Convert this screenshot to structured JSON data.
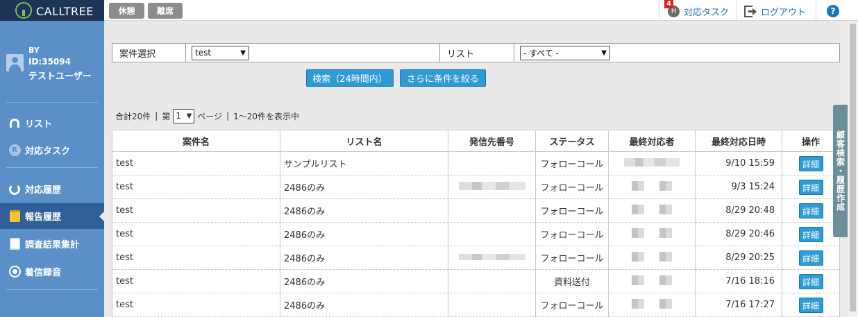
{
  "app": {
    "logo_text": "CALLTREE"
  },
  "topbar": {
    "buttons": [
      "休憩",
      "離席"
    ],
    "task": {
      "badge": "4",
      "icon_letter": "H",
      "label": "対応タスク"
    },
    "logout_label": "ログアウト",
    "help_symbol": "?"
  },
  "user": {
    "by": "BY",
    "id": "ID:35094",
    "name": "テストユーザー"
  },
  "sidebar": {
    "items": [
      {
        "label": "リスト",
        "icon": "headset-icon"
      },
      {
        "label": "対応タスク",
        "icon": "task-icon",
        "icon_letter": "R"
      },
      {
        "label": "対応履歴",
        "icon": "history-icon"
      },
      {
        "label": "報告履歴",
        "icon": "report-icon",
        "active": true
      },
      {
        "label": "調査結果集計",
        "icon": "clipboard-icon"
      },
      {
        "label": "着信録音",
        "icon": "record-icon"
      }
    ]
  },
  "search": {
    "case_label": "案件選択",
    "case_value": "test",
    "list_label": "リスト",
    "list_value": "- すべて -",
    "search_button": "検索（24時間内）",
    "refine_button": "さらに条件を絞る"
  },
  "pager": {
    "total": "合計20件",
    "sep1": "|",
    "page_prefix": "第",
    "page_value": "1",
    "page_suffix": "ページ",
    "sep2": "|",
    "range": "1～20件を表示中"
  },
  "side_tab": "顧客検索・履歴作成",
  "table": {
    "headers": [
      "案件名",
      "リスト名",
      "発信先番号",
      "ステータス",
      "最終対応者",
      "最終対応日時",
      "操作"
    ],
    "rows": [
      {
        "case": "test",
        "list": "サンプルリスト",
        "status": "フォローコール",
        "datetime": "9/10 15:59",
        "action": "詳細"
      },
      {
        "case": "test",
        "list": "2486のみ",
        "status": "フォローコール",
        "datetime": "9/3 15:24",
        "action": "詳細"
      },
      {
        "case": "test",
        "list": "2486のみ",
        "status": "フォローコール",
        "datetime": "8/29 20:48",
        "action": "詳細"
      },
      {
        "case": "test",
        "list": "2486のみ",
        "status": "フォローコール",
        "datetime": "8/29 20:46",
        "action": "詳細"
      },
      {
        "case": "test",
        "list": "2486のみ",
        "status": "フォローコール",
        "datetime": "8/29 20:25",
        "action": "詳細"
      },
      {
        "case": "test",
        "list": "2486のみ",
        "status": "資料送付",
        "datetime": "7/16 18:16",
        "action": "詳細"
      },
      {
        "case": "test",
        "list": "2486のみ",
        "status": "フォローコール",
        "datetime": "7/16 17:27",
        "action": "詳細"
      }
    ]
  },
  "colors": {
    "sidebar": "#5a8fc8",
    "sidebar_active": "#2f5f96",
    "header": "#1e3557",
    "accent_button": "#2e9ad6",
    "link": "#1b75bb",
    "badge": "#e0201b"
  }
}
